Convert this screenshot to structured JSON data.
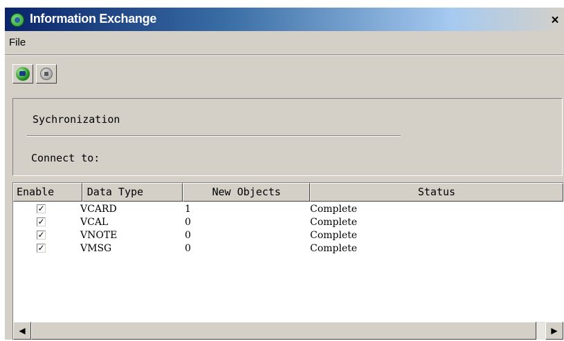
{
  "window": {
    "title": "Information Exchange",
    "close_glyph": "×"
  },
  "menu": {
    "items": [
      {
        "label": "File"
      }
    ]
  },
  "toolbar": {
    "buttons": [
      {
        "name": "connect",
        "icon": "globe-go-icon",
        "color": "#1d8c1d"
      },
      {
        "name": "stop",
        "icon": "stop-icon",
        "color": "#8a8a8a"
      }
    ]
  },
  "sync": {
    "label": "Sychronization",
    "connect_label": "Connect to:"
  },
  "table": {
    "columns": [
      "Enable",
      "Data Type",
      "New Objects",
      "Status"
    ],
    "rows": [
      {
        "enabled": true,
        "checkmark": "✓",
        "type": "VCARD",
        "new": "1",
        "status": "Complete"
      },
      {
        "enabled": true,
        "checkmark": "✓",
        "type": "VCAL",
        "new": "0",
        "status": "Complete"
      },
      {
        "enabled": true,
        "checkmark": "✓",
        "type": "VNOTE",
        "new": "0",
        "status": "Complete"
      },
      {
        "enabled": true,
        "checkmark": "✓",
        "type": "VMSG",
        "new": "0",
        "status": "Complete"
      }
    ]
  },
  "scrollbar": {
    "left_arrow": "◀",
    "right_arrow": "▶"
  },
  "colors": {
    "titlebar_start": "#0a246a",
    "face": "#d4d0c8"
  }
}
